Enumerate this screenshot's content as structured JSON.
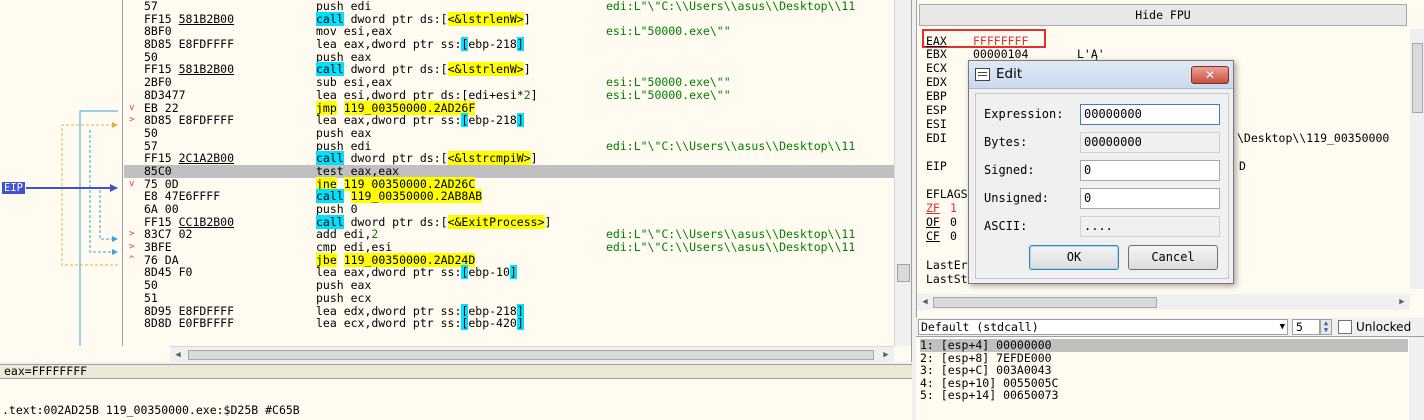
{
  "disasm": {
    "eip_label": "EIP",
    "rows": [
      {
        "mark": "",
        "bytes": "57",
        "bytes_ref": "",
        "mnemonic": "push edi",
        "comment": "edi:L\"\\\"C:\\\\Users\\\\asus\\\\Desktop\\\\11"
      },
      {
        "mark": "",
        "bytes": "FF15 ",
        "bytes_ref": "581B2B00",
        "mnemonic": "call dword ptr ds:[<&lstrlenW>]",
        "comment": ""
      },
      {
        "mark": "",
        "bytes": "8BF0",
        "bytes_ref": "",
        "mnemonic": "mov esi,eax",
        "comment": "esi:L\"50000.exe\\\"\""
      },
      {
        "mark": "",
        "bytes": "8D85 E8FDFFFF",
        "bytes_ref": "",
        "mnemonic": "lea eax,dword ptr ss:[ebp-218]",
        "comment": ""
      },
      {
        "mark": "",
        "bytes": "50",
        "bytes_ref": "",
        "mnemonic": "push eax",
        "comment": ""
      },
      {
        "mark": "",
        "bytes": "FF15 ",
        "bytes_ref": "581B2B00",
        "mnemonic": "call dword ptr ds:[<&lstrlenW>]",
        "comment": ""
      },
      {
        "mark": "",
        "bytes": "2BF0",
        "bytes_ref": "",
        "mnemonic": "sub esi,eax",
        "comment": "esi:L\"50000.exe\\\"\""
      },
      {
        "mark": "",
        "bytes": "8D3477",
        "bytes_ref": "",
        "mnemonic": "lea esi,dword ptr ds:[edi+esi*2]",
        "comment": "esi:L\"50000.exe\\\"\""
      },
      {
        "mark": "v",
        "bytes": "EB 22",
        "bytes_ref": "",
        "mnemonic": "jmp 119_00350000.2AD26F",
        "comment": ""
      },
      {
        "mark": ">",
        "bytes": "8D85 E8FDFFFF",
        "bytes_ref": "",
        "mnemonic": "lea eax,dword ptr ss:[ebp-218]",
        "comment": ""
      },
      {
        "mark": "",
        "bytes": "50",
        "bytes_ref": "",
        "mnemonic": "push eax",
        "comment": ""
      },
      {
        "mark": "",
        "bytes": "57",
        "bytes_ref": "",
        "mnemonic": "push edi",
        "comment": "edi:L\"\\\"C:\\\\Users\\\\asus\\\\Desktop\\\\11"
      },
      {
        "mark": "",
        "bytes": "FF15 ",
        "bytes_ref": "2C1A2B00",
        "mnemonic": "call dword ptr ds:[<&lstrcmpiW>]",
        "comment": ""
      },
      {
        "mark": "",
        "bytes": "85C0",
        "bytes_ref": "",
        "mnemonic": "test eax,eax",
        "comment": ""
      },
      {
        "mark": "v",
        "bytes": "75 0D",
        "bytes_ref": "",
        "mnemonic": "jne 119_00350000.2AD26C",
        "comment": ""
      },
      {
        "mark": "",
        "bytes": "E8 47E6FFFF",
        "bytes_ref": "",
        "mnemonic": "call 119_00350000.2AB8AB",
        "comment": ""
      },
      {
        "mark": "",
        "bytes": "6A 00",
        "bytes_ref": "",
        "mnemonic": "push 0",
        "comment": ""
      },
      {
        "mark": "",
        "bytes": "FF15 ",
        "bytes_ref": "CC1B2B00",
        "mnemonic": "call dword ptr ds:[<&ExitProcess>]",
        "comment": ""
      },
      {
        "mark": ">",
        "bytes": "83C7 02",
        "bytes_ref": "",
        "mnemonic": "add edi,2",
        "comment": "edi:L\"\\\"C:\\\\Users\\\\asus\\\\Desktop\\\\11"
      },
      {
        "mark": ">",
        "bytes": "3BFE",
        "bytes_ref": "",
        "mnemonic": "cmp edi,esi",
        "comment": "edi:L\"\\\"C:\\\\Users\\\\asus\\\\Desktop\\\\11"
      },
      {
        "mark": "^",
        "bytes": "76 DA",
        "bytes_ref": "",
        "mnemonic": "jbe 119_00350000.2AD24D",
        "comment": ""
      },
      {
        "mark": "",
        "bytes": "8D45 F0",
        "bytes_ref": "",
        "mnemonic": "lea eax,dword ptr ss:[ebp-10]",
        "comment": ""
      },
      {
        "mark": "",
        "bytes": "50",
        "bytes_ref": "",
        "mnemonic": "push eax",
        "comment": ""
      },
      {
        "mark": "",
        "bytes": "51",
        "bytes_ref": "",
        "mnemonic": "push ecx",
        "comment": ""
      },
      {
        "mark": "",
        "bytes": "8D95 E8FDFFFF",
        "bytes_ref": "",
        "mnemonic": "lea edx,dword ptr ss:[ebp-218]",
        "comment": ""
      },
      {
        "mark": "",
        "bytes": "8D8D E0FBFFFF",
        "bytes_ref": "",
        "mnemonic": "lea ecx,dword ptr ss:[ebp-420]",
        "comment": ""
      }
    ],
    "current_row": 13
  },
  "info_line": "eax=FFFFFFFF",
  "status_text": ".text:002AD25B 119_00350000.exe:$D25B #C65B",
  "registers": {
    "hide_fpu_label": "Hide FPU",
    "regs": [
      {
        "name": "EAX",
        "value": "FFFFFFFF",
        "extra": ""
      },
      {
        "name": "EBX",
        "value": "00000104",
        "extra": "L'Ą'"
      },
      {
        "name": "ECX",
        "value": "",
        "extra": ""
      },
      {
        "name": "EDX",
        "value": "",
        "extra": ""
      },
      {
        "name": "EBP",
        "value": "",
        "extra": ""
      },
      {
        "name": "ESP",
        "value": "",
        "extra": ""
      },
      {
        "name": "ESI",
        "value": "",
        "extra": ""
      },
      {
        "name": "EDI",
        "value": "",
        "extra": "\\Desktop\\\\119_00350000"
      },
      {
        "name": "EIP",
        "value": "",
        "extra": "D"
      }
    ],
    "eflags_label": "EFLAGS",
    "flags": [
      {
        "name": "ZF",
        "value": "1"
      },
      {
        "name": "OF",
        "value": "0"
      },
      {
        "name": "CF",
        "value": "0"
      }
    ],
    "last_err": "LastEr",
    "last_st": "LastSt",
    "color_eax_changed": "#e03030"
  },
  "callbar": {
    "convention": "Default (stdcall)",
    "arg_count": "5",
    "unlocked_label": "Unlocked"
  },
  "stack": [
    "1: [esp+4] 00000000",
    "2: [esp+8] 7EFDE000",
    "3: [esp+C] 003A0043",
    "4: [esp+10] 0055005C",
    "5: [esp+14] 00650073"
  ],
  "dialog": {
    "title": "Edit",
    "close_glyph": "✕",
    "fields": [
      {
        "label": "Expression:",
        "value": "00000000",
        "readonly": false
      },
      {
        "label": "Bytes:",
        "value": "00000000",
        "readonly": true
      },
      {
        "label": "Signed:",
        "value": "0",
        "readonly": false
      },
      {
        "label": "Unsigned:",
        "value": "0",
        "readonly": false
      },
      {
        "label": "ASCII:",
        "value": "....",
        "readonly": true
      }
    ],
    "ok_label": "OK",
    "cancel_label": "Cancel"
  }
}
